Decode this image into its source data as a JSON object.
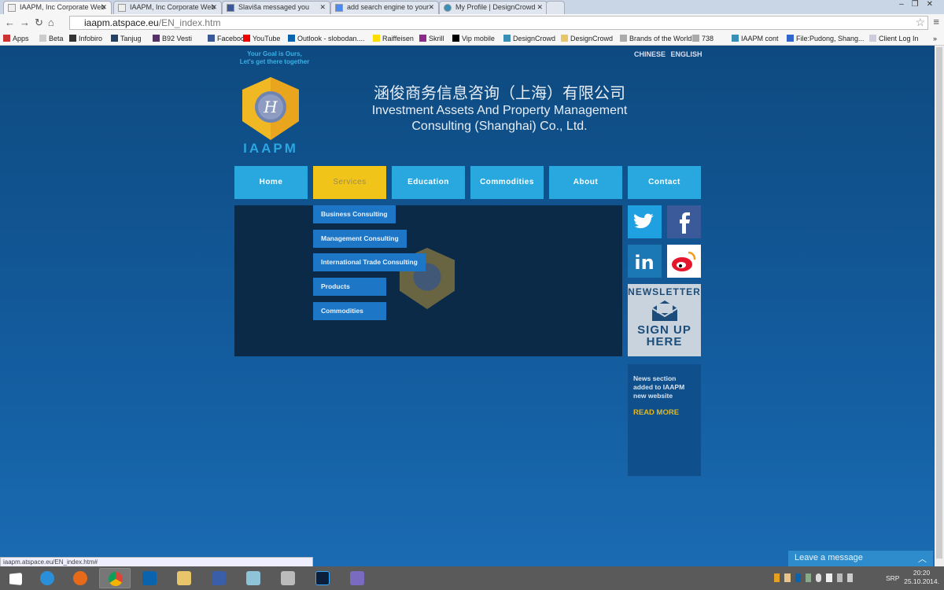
{
  "browser": {
    "tabs": [
      {
        "title": "IAAPM, Inc Corporate Web",
        "active": true
      },
      {
        "title": "IAAPM, Inc Corporate Web"
      },
      {
        "title": "Slaviša messaged you"
      },
      {
        "title": "add search engine to your"
      },
      {
        "title": "My Profile | DesignCrowd"
      }
    ],
    "url_host": "iaapm.atspace.eu",
    "url_path": "/EN_index.htm",
    "bookmarks": [
      "Apps",
      "Beta",
      "Infobiro",
      "Tanjug",
      "B92 Vesti",
      "Facebook",
      "YouTube",
      "Outlook - slobodan....",
      "Raiffeisen",
      "Skrill",
      "Vip mobile",
      "DesignCrowd",
      "DesignCrowd",
      "Brands of the World™",
      "738",
      "IAAPM cont",
      "File:Pudong, Shang...",
      "Client Log In"
    ],
    "status_url": "iaapm.atspace.eu/EN_index.htm#"
  },
  "header": {
    "tagline_1": "Your Goal is Ours,",
    "tagline_2": "Let's get there together",
    "lang_cn": "CHINESE",
    "lang_en": "ENGLISH",
    "brand": "IAAPM",
    "title_cn": "涵俊商务信息咨询（上海）有限公司",
    "title_en_1": "Investment Assets And Property Management",
    "title_en_2": "Consulting (Shanghai) Co., Ltd."
  },
  "nav": [
    "Home",
    "Services",
    "Education",
    "Commodities",
    "About",
    "Contact"
  ],
  "dropdown": [
    "Business Consulting",
    "Management Consulting",
    "International Trade Consulting",
    "Products",
    "Commodities"
  ],
  "newsletter": {
    "title": "NEWSLETTER",
    "cta_1": "SIGN UP",
    "cta_2": "HERE"
  },
  "news": {
    "text": "News section added to IAAPM new website",
    "link": "READ MORE"
  },
  "chat": {
    "label": "Leave a message"
  },
  "taskbar": {
    "lang": "SRP",
    "time": "20:20",
    "date": "25.10.2014."
  },
  "colors": {
    "nav": "#29a8e0",
    "nav_active": "#f0c419",
    "panel": "#0a2a48",
    "dropdown": "#1d77c6"
  }
}
